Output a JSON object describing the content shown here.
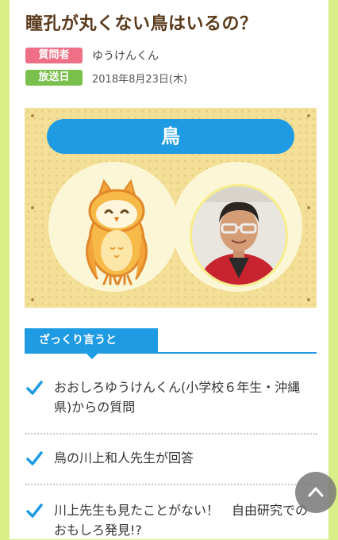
{
  "article": {
    "title": "瞳孔が丸くない鳥はいるの？",
    "asker_tag": "質問者",
    "asker_name": "ゆうけんくん",
    "date_tag": "放送日",
    "date": "2018年8月23日(木)"
  },
  "hero": {
    "subject": "鳥"
  },
  "summary": {
    "heading": "ざっくり言うと",
    "items": [
      "おおしろゆうけんくん(小学校６年生・沖縄県)からの質問",
      "鳥の川上和人先生が回答",
      "川上先生も見たことがない！　自由研究でのおもしろ発見!?"
    ]
  },
  "colors": {
    "background": "#d9ee86",
    "accent_blue": "#1f9be3",
    "asker_pink": "#ee6f86",
    "date_green": "#7ac04c",
    "title_brown": "#5b3a1c"
  },
  "icons": {
    "check": "check-icon",
    "owl": "owl-illustration",
    "scroll_top": "chevron-up-icon"
  }
}
